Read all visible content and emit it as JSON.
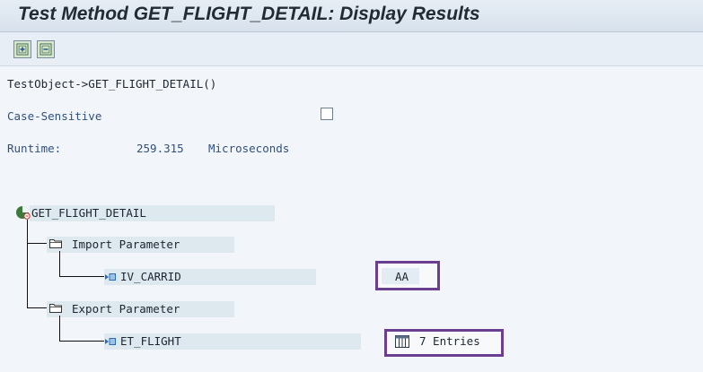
{
  "window": {
    "title": "Test Method GET_FLIGHT_DETAIL: Display Results"
  },
  "toolbar": {
    "buttons": [
      {
        "name": "expand-all",
        "icon": "expand-tree-icon"
      },
      {
        "name": "collapse-all",
        "icon": "collapse-tree-icon"
      }
    ]
  },
  "main": {
    "call_line": "TestObject->GET_FLIGHT_DETAIL()",
    "case_sensitive_label": "Case-Sensitive",
    "case_sensitive_checked": false,
    "runtime_label": "Runtime:",
    "runtime_value": "259.315",
    "runtime_unit": "Microseconds"
  },
  "tree": {
    "root_label": "GET_FLIGHT_DETAIL",
    "import_label": "Import Parameter",
    "import_param": "IV_CARRID",
    "import_value": "AA",
    "export_label": "Export Parameter",
    "export_param": "ET_FLIGHT",
    "export_value": "7 Entries"
  },
  "colors": {
    "highlight_border": "#6b3f8f",
    "label_blue": "#2f4f80"
  }
}
